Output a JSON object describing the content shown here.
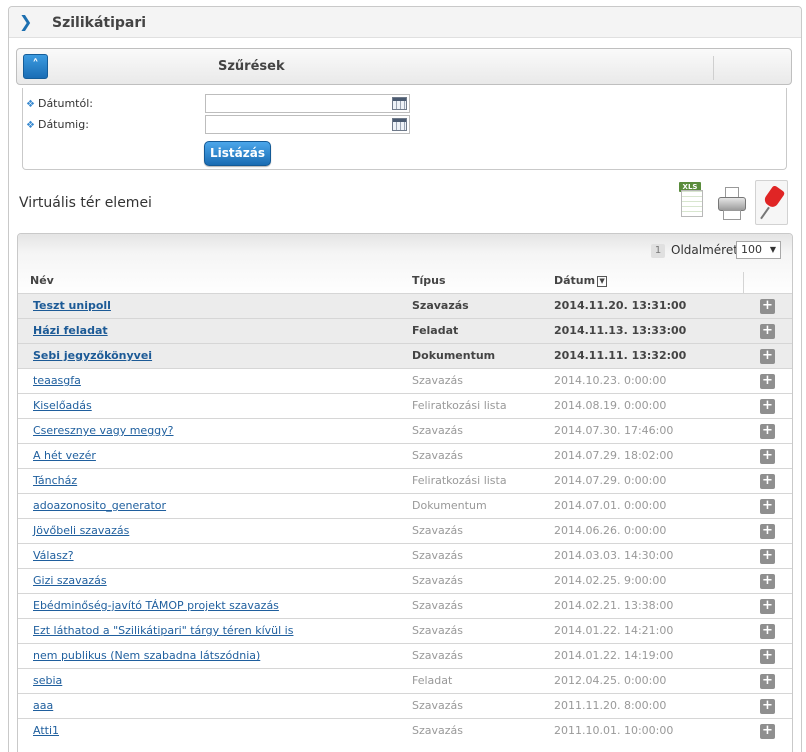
{
  "header": {
    "title": "Szilikátipari"
  },
  "filters": {
    "title": "Szűrések",
    "date_from_label": "Dátumtól:",
    "date_to_label": "Dátumig:",
    "date_from_value": "",
    "date_to_value": "",
    "list_button": "Listázás"
  },
  "section": {
    "title": "Virtuális tér elemei",
    "xls_label": "XLS"
  },
  "grid": {
    "page_number": "1",
    "page_size_label": "Oldalméret",
    "page_size_value": "100",
    "columns": {
      "name": "Név",
      "type": "Típus",
      "date": "Dátum"
    },
    "rows": [
      {
        "name": "Teszt unipoll",
        "type": "Szavazás",
        "date": "2014.11.20. 13:31:00"
      },
      {
        "name": "Házi feladat",
        "type": "Feladat",
        "date": "2014.11.13. 13:33:00"
      },
      {
        "name": "Sebi jegyzőkönyvei",
        "type": "Dokumentum",
        "date": "2014.11.11. 13:32:00"
      },
      {
        "name": "teaasgfa",
        "type": "Szavazás",
        "date": "2014.10.23. 0:00:00"
      },
      {
        "name": "Kiselőadás",
        "type": "Feliratkozási lista",
        "date": "2014.08.19. 0:00:00"
      },
      {
        "name": "Cseresznye vagy meggy?",
        "type": "Szavazás",
        "date": "2014.07.30. 17:46:00"
      },
      {
        "name": "A hét vezér",
        "type": "Szavazás",
        "date": "2014.07.29. 18:02:00"
      },
      {
        "name": "Táncház",
        "type": "Feliratkozási lista",
        "date": "2014.07.29. 0:00:00"
      },
      {
        "name": "adoazonosito_generator",
        "type": "Dokumentum",
        "date": "2014.07.01. 0:00:00"
      },
      {
        "name": "Jövőbeli szavazás",
        "type": "Szavazás",
        "date": "2014.06.26. 0:00:00"
      },
      {
        "name": "Válasz?",
        "type": "Szavazás",
        "date": "2014.03.03. 14:30:00"
      },
      {
        "name": "Gizi szavazás",
        "type": "Szavazás",
        "date": "2014.02.25. 9:00:00"
      },
      {
        "name": "Ebédminőség-javító TÁMOP projekt szavazás",
        "type": "Szavazás",
        "date": "2014.02.21. 13:38:00"
      },
      {
        "name": "Ezt láthatod a \"Szilikátipari\" tárgy téren kívül is",
        "type": "Szavazás",
        "date": "2014.01.22. 14:21:00"
      },
      {
        "name": "nem publikus (Nem szabadna látszódnia)",
        "type": "Szavazás",
        "date": "2014.01.22. 14:19:00"
      },
      {
        "name": "sebia",
        "type": "Feladat",
        "date": "2012.04.25. 0:00:00"
      },
      {
        "name": "aaa",
        "type": "Szavazás",
        "date": "2011.11.20. 8:00:00"
      },
      {
        "name": "Atti1",
        "type": "Szavazás",
        "date": "2011.10.01. 10:00:00"
      }
    ]
  }
}
